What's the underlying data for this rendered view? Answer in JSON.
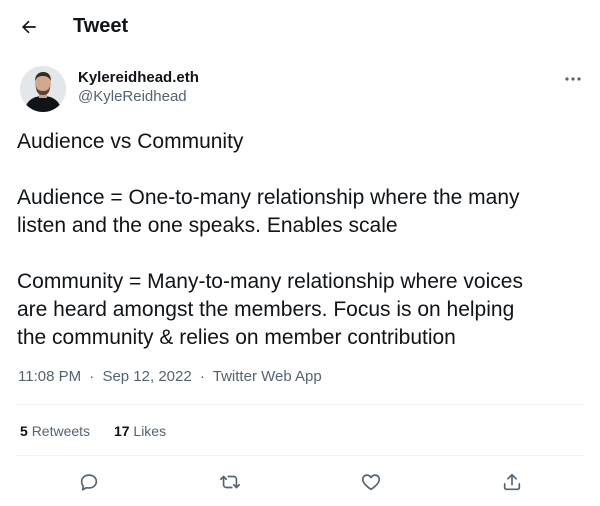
{
  "header": {
    "back_icon": "arrow-left-icon",
    "title": "Tweet"
  },
  "author": {
    "display_name": "Kylereidhead.eth",
    "handle": "@KyleReidhead",
    "more_icon": "more-horizontal-icon"
  },
  "tweet": {
    "paragraphs": [
      [
        "Audience vs Community"
      ],
      [
        "Audience = One-to-many relationship where the many",
        "listen and the one speaks. Enables scale"
      ],
      [
        "Community = Many-to-many relationship where voices",
        "are heard amongst the members. Focus is on helping",
        "the community & relies on member contribution"
      ]
    ],
    "time": "11:08 PM",
    "separator": "·",
    "date": "Sep 12, 2022",
    "source": "Twitter Web App"
  },
  "stats": {
    "retweets_count": "5",
    "retweets_label": "Retweets",
    "likes_count": "17",
    "likes_label": "Likes"
  },
  "actions": [
    {
      "name": "reply",
      "icon": "reply-icon"
    },
    {
      "name": "retweet",
      "icon": "retweet-icon"
    },
    {
      "name": "like",
      "icon": "heart-icon"
    },
    {
      "name": "share",
      "icon": "share-icon"
    }
  ],
  "colors": {
    "text": "#0f1419",
    "secondary": "#536471",
    "divider": "#eff3f4"
  }
}
